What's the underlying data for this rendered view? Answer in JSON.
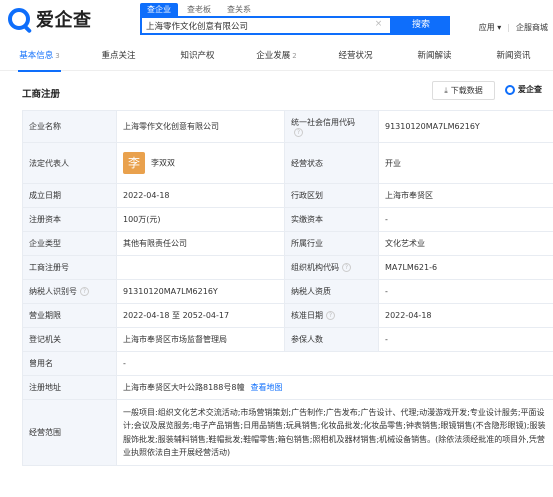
{
  "search": {
    "tabs": [
      "查企业",
      "查老板",
      "查关系"
    ],
    "value": "上海零作文化创意有限公司",
    "button": "搜索"
  },
  "brand": {
    "name": "爱企查"
  },
  "top_right": {
    "app": "应用",
    "mall": "企服商城"
  },
  "nav": [
    {
      "label": "基本信息",
      "count": "3"
    },
    {
      "label": "重点关注",
      "count": ""
    },
    {
      "label": "知识产权",
      "count": ""
    },
    {
      "label": "企业发展",
      "count": "2"
    },
    {
      "label": "经营状况",
      "count": ""
    },
    {
      "label": "新闻解读",
      "count": ""
    },
    {
      "label": "新闻资讯",
      "count": ""
    }
  ],
  "section": {
    "title": "工商注册",
    "download": "下载数据",
    "brand": "爱企查"
  },
  "rows": {
    "company_name_label": "企业名称",
    "company_name": "上海零作文化创意有限公司",
    "credit_code_label": "统一社会信用代码",
    "credit_code": "91310120MA7LM6216Y",
    "legal_rep_label": "法定代表人",
    "legal_rep_avatar": "李",
    "legal_rep": "李双双",
    "status_label": "经营状态",
    "status": "开业",
    "founded_label": "成立日期",
    "founded": "2022-04-18",
    "district_label": "行政区划",
    "district": "上海市奉贤区",
    "capital_label": "注册资本",
    "capital": "100万(元)",
    "paid_capital_label": "实缴资本",
    "paid_capital": "-",
    "type_label": "企业类型",
    "type": "其他有限责任公司",
    "industry_label": "所属行业",
    "industry": "文化艺术业",
    "reg_no_label": "工商注册号",
    "reg_no": "",
    "org_code_label": "组织机构代码",
    "org_code": "MA7LM621-6",
    "taxpayer_id_label": "纳税人识别号",
    "taxpayer_id": "91310120MA7LM6216Y",
    "taxpayer_qual_label": "纳税人资质",
    "taxpayer_qual": "-",
    "term_label": "营业期限",
    "term": "2022-04-18 至 2052-04-17",
    "approve_label": "核准日期",
    "approve": "2022-04-18",
    "authority_label": "登记机关",
    "authority": "上海市奉贤区市场监督管理局",
    "insured_label": "参保人数",
    "insured": "-",
    "former_label": "曾用名",
    "former": "-",
    "address_label": "注册地址",
    "address": "上海市奉贤区大叶公路8188号8幢",
    "map_link": "查看地图",
    "scope_label": "经营范围",
    "scope": "一般项目:组织文化艺术交流活动;市场营销策划;广告制作;广告发布;广告设计、代理;动漫游戏开发;专业设计服务;平面设计;会议及展览服务;电子产品销售;日用品销售;玩具销售;化妆品批发;化妆品零售;钟表销售;眼镜销售(不含隐形眼镜);服装服饰批发;服装辅料销售;鞋帽批发;鞋帽零售;箱包销售;照相机及器材销售;机械设备销售。(除依法须经批准的项目外,凭营业执照依法自主开展经营活动)"
  }
}
